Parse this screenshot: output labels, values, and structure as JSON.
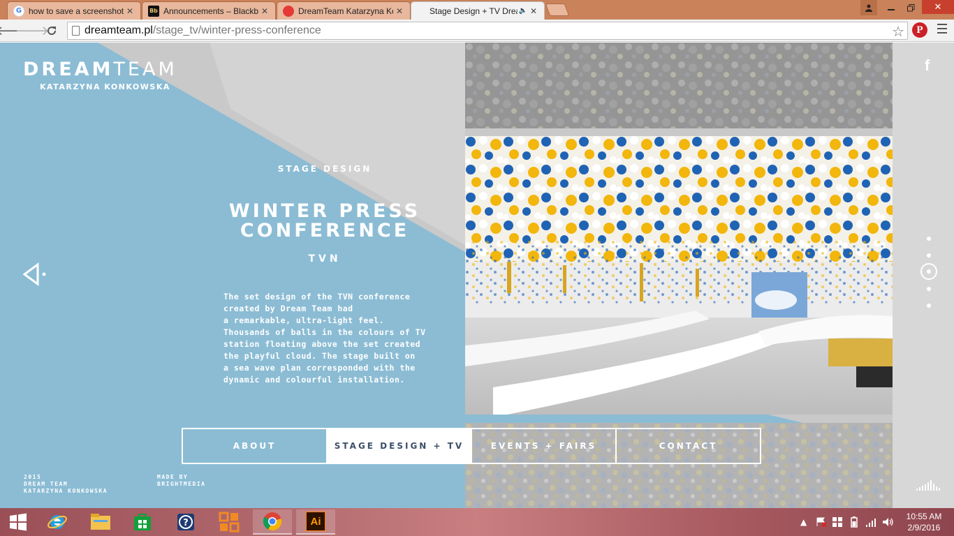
{
  "browser": {
    "tabs": [
      {
        "title": "how to save a screenshot",
        "favicon": "google-icon"
      },
      {
        "title": "Announcements – Blackbo",
        "favicon": "blackboard-icon",
        "favicon_text": "Bb"
      },
      {
        "title": "DreamTeam Katarzyna Kon",
        "favicon": "dreamteam-icon"
      },
      {
        "title": "Stage Design + TV Drea",
        "favicon": "none",
        "active": true,
        "audio": true
      }
    ],
    "url_host": "dreamteam.pl",
    "url_path": "/stage_tv/winter-press-conference",
    "pinterest_label": "P"
  },
  "site": {
    "brand_bold": "DREAM",
    "brand_light": "TEAM",
    "brand_sub": "KATARZYNA KONKOWSKA",
    "category": "STAGE DESIGN",
    "title": "WINTER PRESS CONFERENCE",
    "client": "TVN",
    "description_lines": [
      "The set design of the TVN conference",
      "created by Dream Team had",
      "a remarkable, ultra-light feel.",
      "Thousands of balls in the colours of TV",
      "station floating above the set created",
      "the playful cloud. The stage built on",
      "a sea wave plan corresponded with the",
      "dynamic and colourful installation."
    ],
    "nav": [
      {
        "label": "ABOUT",
        "active": false
      },
      {
        "label": "STAGE DESIGN + TV",
        "active": true
      },
      {
        "label": "EVENTS + FAIRS",
        "active": false
      },
      {
        "label": "CONTACT",
        "active": false
      }
    ],
    "footer_left": [
      "2015",
      "DREAM TEAM",
      "KATARZYNA KONKOWSKA"
    ],
    "footer_right": [
      "MADE BY",
      "BRIGHTMEDIA"
    ],
    "facebook_label": "f",
    "colors": {
      "accent_blue": "#8bbcd4",
      "ball_blue": "#1f63b5",
      "ball_yellow": "#f2b60c"
    }
  },
  "taskbar": {
    "apps": [
      "start-button",
      "internet-explorer-icon",
      "file-explorer-icon",
      "windows-store-icon",
      "help-icon",
      "office-icon",
      "chrome-icon",
      "illustrator-icon"
    ],
    "illustrator_label": "Ai",
    "time": "10:55 AM",
    "date": "2/9/2016"
  }
}
